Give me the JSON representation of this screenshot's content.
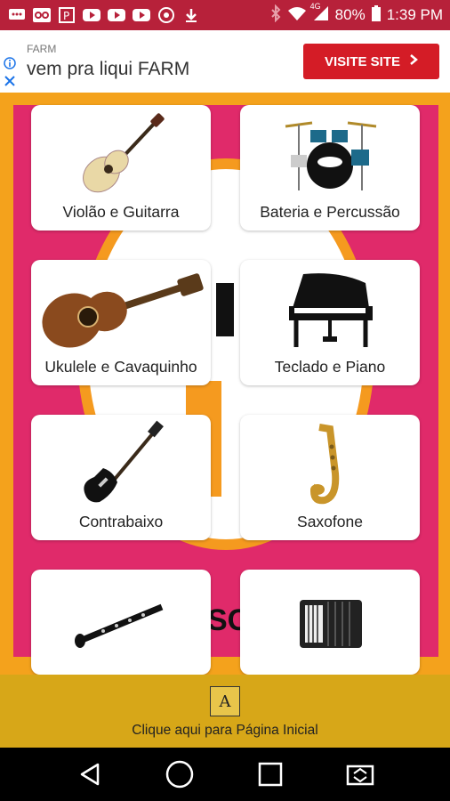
{
  "status_bar": {
    "battery": "80%",
    "time": "1:39 PM",
    "network": "4G",
    "left_icons": [
      "messages-icon",
      "voicemail-icon",
      "flipboard-icon",
      "youtube-icon",
      "youtube-icon",
      "youtube-icon",
      "vpn-icon",
      "download-icon"
    ],
    "right_icons": [
      "bluetooth-icon",
      "wifi-icon",
      "signal-icon",
      "battery-icon"
    ]
  },
  "ad": {
    "brand": "FARM",
    "title": "vem pra liqui FARM",
    "button_label": "VISITE SITE",
    "button_icon": "chevron-right-icon",
    "info_icon": "info-icon",
    "close_icon": "close-icon",
    "button_color": "#d41c26"
  },
  "categories": [
    {
      "label": "Violão e Guitarra",
      "icon": "guitar-icon"
    },
    {
      "label": "Bateria e Percussão",
      "icon": "drum-kit-icon"
    },
    {
      "label": "Ukulele e Cavaquinho",
      "icon": "ukulele-icon"
    },
    {
      "label": "Teclado e Piano",
      "icon": "piano-icon"
    },
    {
      "label": "Contrabaixo",
      "icon": "bass-guitar-icon"
    },
    {
      "label": "Saxofone",
      "icon": "saxophone-icon"
    },
    {
      "label": "",
      "icon": "clarinet-icon"
    },
    {
      "label": "",
      "icon": "accordion-icon"
    }
  ],
  "home": {
    "icon_letter": "A",
    "label": "Clique aqui para Página Inicial"
  },
  "nav": {
    "icons": [
      "back-icon",
      "home-circle-icon",
      "recents-icon",
      "screen-share-icon"
    ]
  },
  "colors": {
    "status_bar": "#b7213a",
    "background": "#f4a21c",
    "panel": "#e02a6a",
    "home_bar": "#d7a718"
  }
}
